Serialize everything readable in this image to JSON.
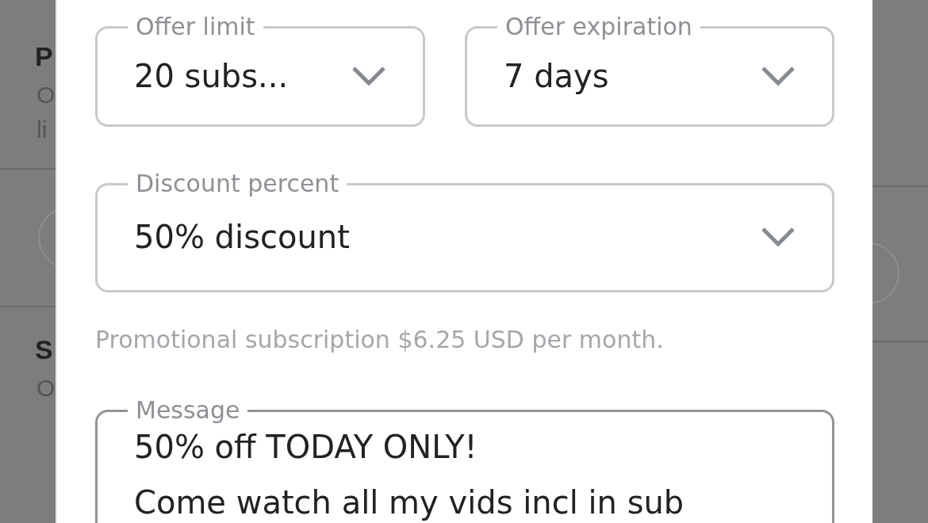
{
  "background": {
    "texts": [
      {
        "kind": "heading",
        "text": "P"
      },
      {
        "kind": "body",
        "text": "O"
      },
      {
        "kind": "body",
        "text": "li"
      },
      {
        "kind": "divider"
      },
      {
        "kind": "circle"
      },
      {
        "kind": "divider"
      },
      {
        "kind": "heading",
        "text": "S"
      },
      {
        "kind": "body",
        "text": "O"
      }
    ]
  },
  "dialog": {
    "selects_row": [
      {
        "label": "Offer limit",
        "value": "20 subs..."
      },
      {
        "label": "Offer expiration",
        "value": "7 days"
      }
    ],
    "discount": {
      "label": "Discount percent",
      "value": "50% discount"
    },
    "hint": "Promotional subscription $6.25 USD per month.",
    "message": {
      "label": "Message",
      "lines": [
        "50% off TODAY ONLY!",
        "Come watch all my vids incl in sub"
      ]
    }
  }
}
